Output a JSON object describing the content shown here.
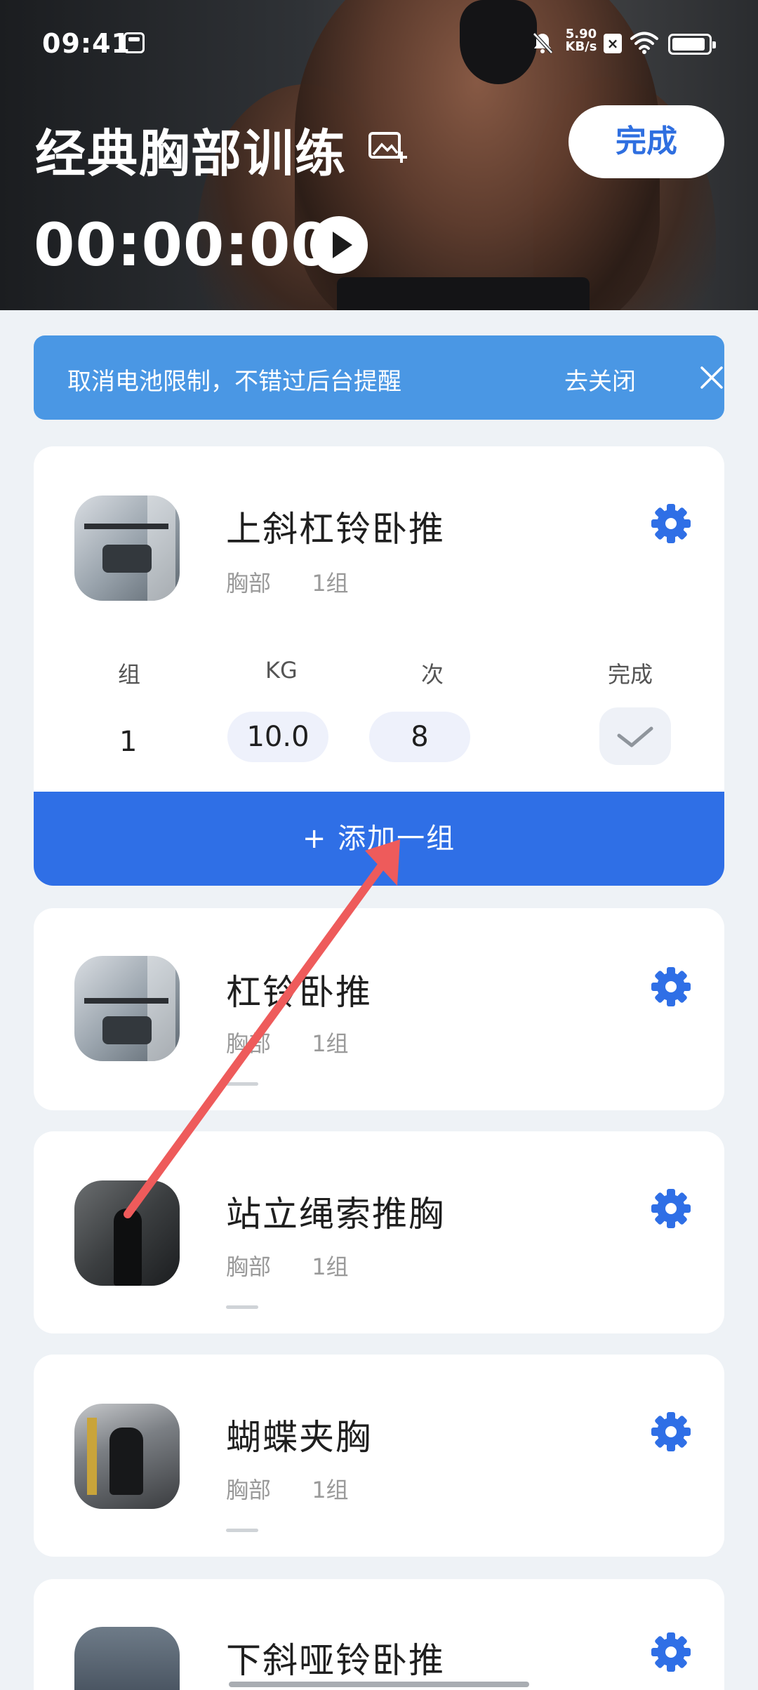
{
  "status_bar": {
    "time": "09:41",
    "speed_value": "5.90",
    "speed_unit": "KB/s",
    "x_badge": "×"
  },
  "header": {
    "title": "经典胸部训练",
    "done_label": "完成",
    "timer": "00:00:00"
  },
  "banner": {
    "text": "取消电池限制，不错过后台提醒",
    "action_label": "去关闭"
  },
  "exercises": [
    {
      "name": "上斜杠铃卧推",
      "part": "胸部",
      "sets_label": "1组",
      "expanded": true,
      "columns": {
        "set": "组",
        "kg": "KG",
        "reps": "次",
        "done": "完成"
      },
      "rows": [
        {
          "set": "1",
          "kg": "10.0",
          "reps": "8"
        }
      ],
      "add_set_label": "+ 添加一组"
    },
    {
      "name": "杠铃卧推",
      "part": "胸部",
      "sets_label": "1组"
    },
    {
      "name": "站立绳索推胸",
      "part": "胸部",
      "sets_label": "1组"
    },
    {
      "name": "蝴蝶夹胸",
      "part": "胸部",
      "sets_label": "1组"
    },
    {
      "name": "下斜哑铃卧推"
    }
  ],
  "colors": {
    "accent": "#2f6fe6",
    "banner": "#4a97e4",
    "annotation_arrow": "#ee5b5b",
    "background": "#eef2f6"
  },
  "icons": {
    "status_app": "app-notification-icon",
    "mute": "bell-off-icon",
    "wifi": "wifi-icon",
    "battery": "battery-icon",
    "title_edit": "image-edit-icon",
    "play": "play-icon",
    "close": "close-icon",
    "settings": "gear-icon",
    "check": "check-icon"
  }
}
